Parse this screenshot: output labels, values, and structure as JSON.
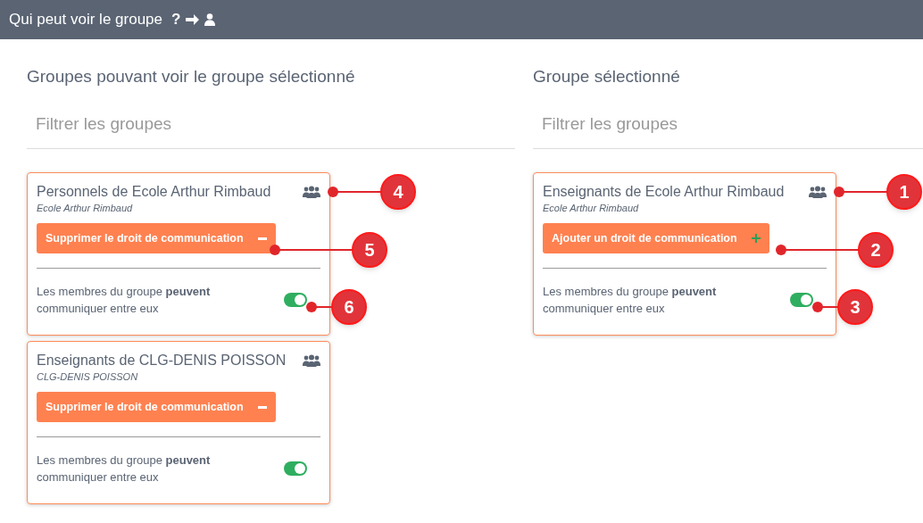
{
  "header": {
    "title": "Qui peut voir le groupe",
    "question_mark": "?"
  },
  "columns": [
    {
      "heading": "Groupes pouvant voir le groupe sélectionné",
      "filter": {
        "placeholder": "Filtrer les groupes"
      },
      "cards": [
        {
          "title": "Personnels de Ecole Arthur Rimbaud",
          "subtitle": "Ecole Arthur Rimbaud",
          "button": {
            "kind": "remove",
            "label": "Supprimer le droit de communication"
          },
          "toggle_text": "Les membres du groupe **peuvent** communiquer entre eux",
          "toggle_on": true,
          "callouts": [
            {
              "kind": "icon",
              "number": "4"
            },
            {
              "kind": "button",
              "number": "5"
            },
            {
              "kind": "toggle",
              "number": "6"
            }
          ]
        },
        {
          "title": "Enseignants de CLG-DENIS POISSON",
          "subtitle": "CLG-DENIS POISSON",
          "button": {
            "kind": "remove",
            "label": "Supprimer le droit de communication"
          },
          "toggle_text": "Les membres du groupe **peuvent** communiquer entre eux",
          "toggle_on": true
        }
      ]
    },
    {
      "heading": "Groupe sélectionné",
      "filter": {
        "placeholder": "Filtrer les groupes"
      },
      "cards": [
        {
          "title": "Enseignants de Ecole Arthur Rimbaud",
          "subtitle": "Ecole Arthur Rimbaud",
          "button": {
            "kind": "add",
            "label": "Ajouter un droit de communication"
          },
          "toggle_text": "Les membres du groupe **peuvent** communiquer entre eux",
          "toggle_on": true,
          "callouts": [
            {
              "kind": "icon",
              "number": "1"
            },
            {
              "kind": "button",
              "number": "2"
            },
            {
              "kind": "toggle",
              "number": "3"
            }
          ]
        }
      ]
    }
  ]
}
